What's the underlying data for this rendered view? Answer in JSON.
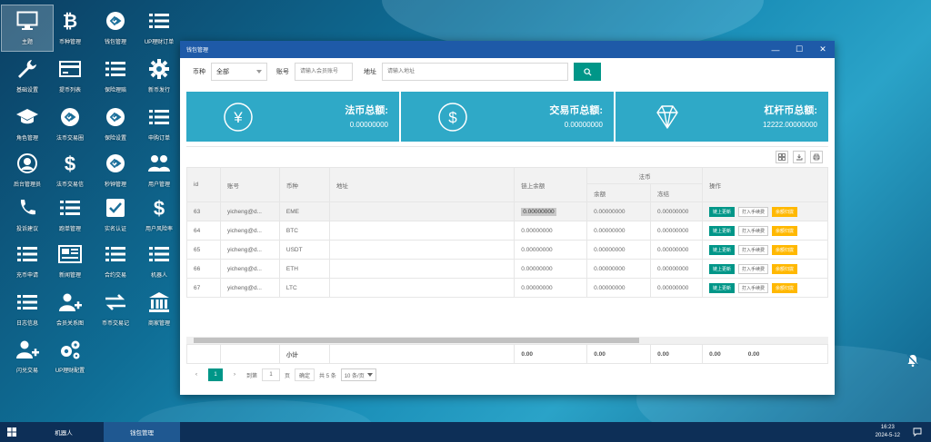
{
  "desktop_icons": [
    {
      "label": "主题",
      "icon": "monitor-icon"
    },
    {
      "label": "币种管理",
      "icon": "bitcoin-icon"
    },
    {
      "label": "钱包管理",
      "icon": "wallet-icon"
    },
    {
      "label": "UP理财订单",
      "icon": "list-icon"
    },
    {
      "label": "基础设置",
      "icon": "wrench-icon"
    },
    {
      "label": "提币列表",
      "icon": "card-icon"
    },
    {
      "label": "保险理赔",
      "icon": "list-icon"
    },
    {
      "label": "新币发行",
      "icon": "gear-icon"
    },
    {
      "label": "角色管理",
      "icon": "graduation-cap-icon"
    },
    {
      "label": "法币交易圈",
      "icon": "exchange-icon"
    },
    {
      "label": "保险设置",
      "icon": "exchange-icon"
    },
    {
      "label": "申购订单",
      "icon": "list-icon"
    },
    {
      "label": "后台管理员",
      "icon": "user-icon"
    },
    {
      "label": "法币交易信",
      "icon": "dollar-icon"
    },
    {
      "label": "秒钟管理",
      "icon": "exchange-icon"
    },
    {
      "label": "用户管理",
      "icon": "users-icon"
    },
    {
      "label": "投诉建议",
      "icon": "phone-icon"
    },
    {
      "label": "跑单管理",
      "icon": "list-icon"
    },
    {
      "label": "实名认证",
      "icon": "check-icon"
    },
    {
      "label": "用户风险率",
      "icon": "dollar-icon"
    },
    {
      "label": "充币申请",
      "icon": "list-icon"
    },
    {
      "label": "新闻管理",
      "icon": "news-icon"
    },
    {
      "label": "合约交易",
      "icon": "list-icon"
    },
    {
      "label": "机器人",
      "icon": "list-icon"
    },
    {
      "label": "日志信息",
      "icon": "list-icon"
    },
    {
      "label": "会员关系图",
      "icon": "user-plus-icon"
    },
    {
      "label": "币币交易记",
      "icon": "swap-icon"
    },
    {
      "label": "商家管理",
      "icon": "bank-icon"
    },
    {
      "label": "闪兑交易",
      "icon": "user-plus-icon"
    },
    {
      "label": "UP理财配置",
      "icon": "gears-icon"
    }
  ],
  "window": {
    "title": "钱包管理",
    "controls": {
      "minimize": "—",
      "maximize": "☐",
      "close": "✕"
    }
  },
  "filter": {
    "currency_label": "币种",
    "currency_value": "全部",
    "account_label": "账号",
    "account_placeholder": "请输入会员账号",
    "address_label": "地址",
    "address_placeholder": "请输入地址"
  },
  "stats": [
    {
      "title": "法币总额:",
      "value": "0.00000000",
      "icon": "yen-icon"
    },
    {
      "title": "交易币总额:",
      "value": "0.00000000",
      "icon": "dollar-icon"
    },
    {
      "title": "杠杆币总额:",
      "value": "12222.00000000",
      "icon": "diamond-icon"
    }
  ],
  "table": {
    "headers": {
      "id": "id",
      "account": "账号",
      "currency": "币种",
      "address": "地址",
      "chain_balance": "链上余额",
      "fiat": "法币",
      "balance": "余额",
      "frozen": "冻结",
      "action": "操作"
    },
    "rows": [
      {
        "id": "63",
        "account": "yicheng@d...",
        "currency": "EME",
        "address": "",
        "chain_balance": "0.00000000",
        "balance": "0.00000000",
        "frozen": "0.00000000",
        "highlight": true
      },
      {
        "id": "64",
        "account": "yicheng@d...",
        "currency": "BTC",
        "address": "",
        "chain_balance": "0.00000000",
        "balance": "0.00000000",
        "frozen": "0.00000000"
      },
      {
        "id": "65",
        "account": "yicheng@d...",
        "currency": "USDT",
        "address": "",
        "chain_balance": "0.00000000",
        "balance": "0.00000000",
        "frozen": "0.00000000"
      },
      {
        "id": "66",
        "account": "yicheng@d...",
        "currency": "ETH",
        "address": "",
        "chain_balance": "0.00000000",
        "balance": "0.00000000",
        "frozen": "0.00000000"
      },
      {
        "id": "67",
        "account": "yicheng@d...",
        "currency": "LTC",
        "address": "",
        "chain_balance": "0.00000000",
        "balance": "0.00000000",
        "frozen": "0.00000000"
      }
    ],
    "actions": {
      "chain_update": "链上更新",
      "manual_fee": "打入手续费",
      "balance_sweep": "余额归拢"
    },
    "summary": {
      "label": "小计",
      "values": [
        "0.00",
        "0.00",
        "0.00",
        "0.00",
        "0.00"
      ]
    }
  },
  "pager": {
    "prev": "‹",
    "current": "1",
    "next": "›",
    "goto_label": "到第",
    "goto_value": "1",
    "page_label": "页",
    "confirm": "确定",
    "total": "共 5 条",
    "page_size": "10 条/页"
  },
  "taskbar": {
    "tasks": [
      "机器人",
      "钱包管理"
    ],
    "time": "16:23",
    "date": "2024-5-12"
  },
  "colors": {
    "accent": "#009688",
    "stat_bg": "#2fa9c7",
    "title_bar": "#1e5aa8",
    "warn": "#ffb800"
  }
}
